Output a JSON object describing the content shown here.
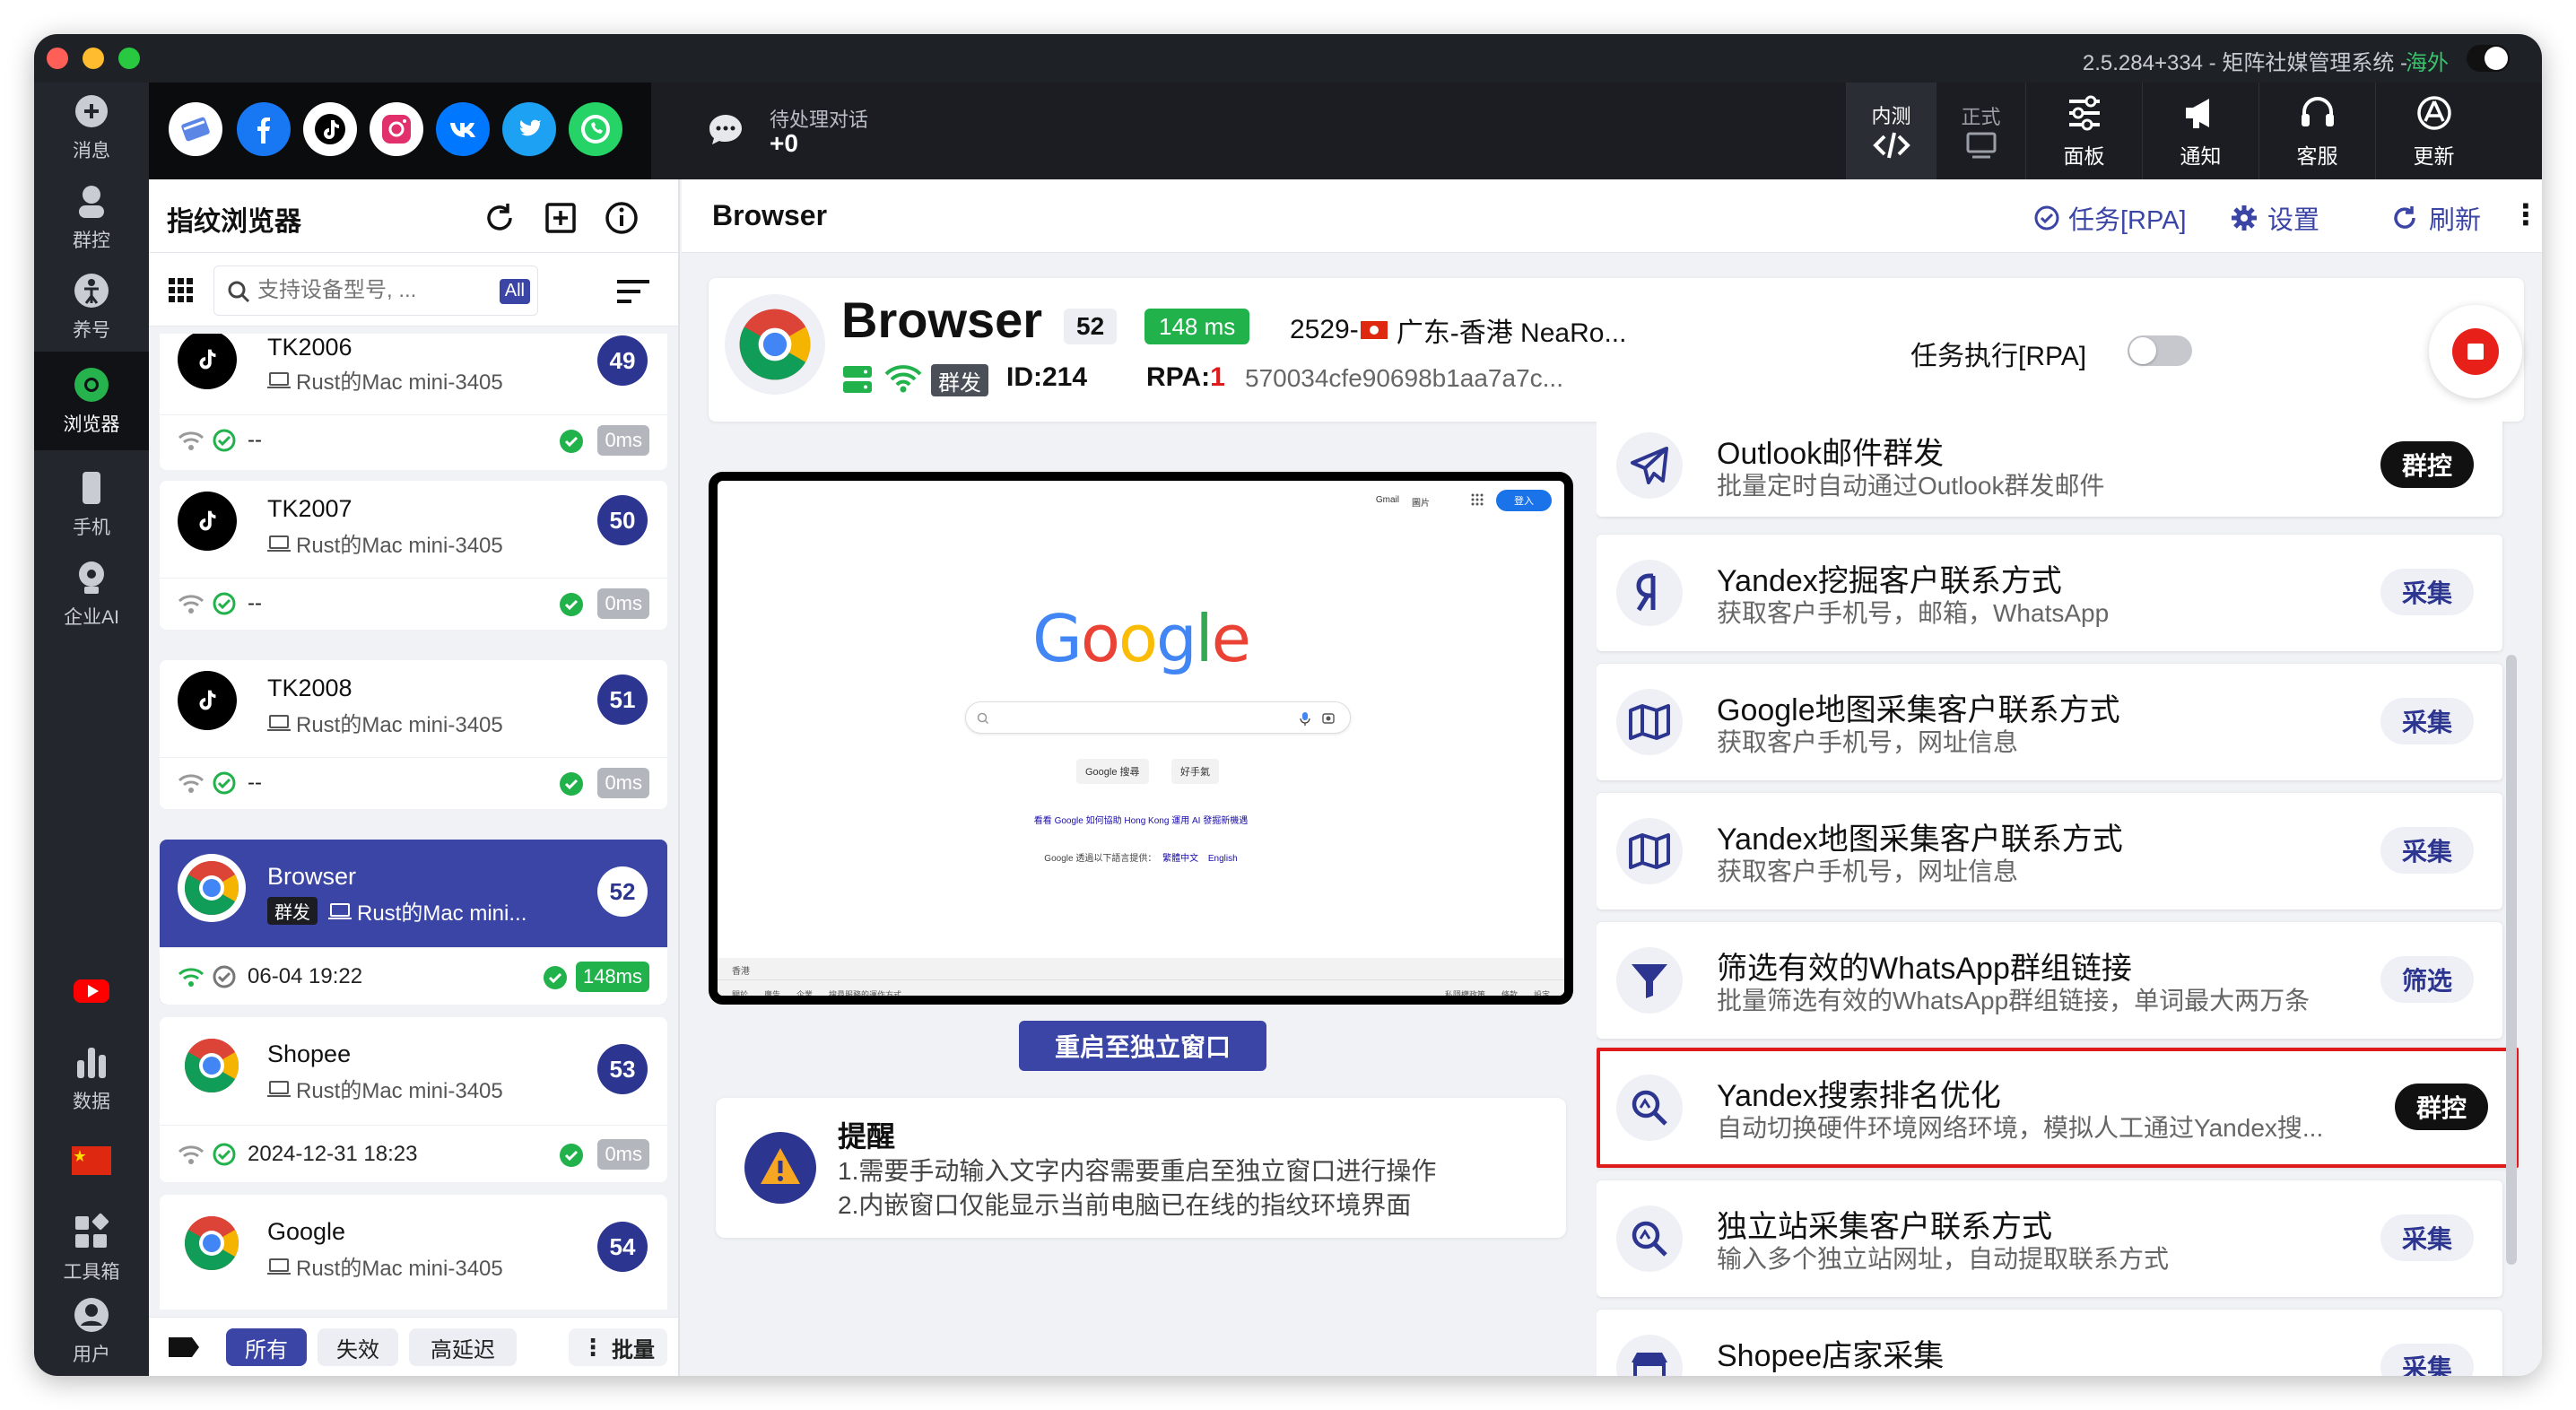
{
  "window": {
    "title": "2.5.284+334 - 矩阵社媒管理系统 - ",
    "region": "海外"
  },
  "sidebar": {
    "items": [
      {
        "label": "消息",
        "icon": "message-icon"
      },
      {
        "label": "群控",
        "icon": "group-control-icon"
      },
      {
        "label": "养号",
        "icon": "account-nurture-icon"
      },
      {
        "label": "浏览器",
        "icon": "browser-icon",
        "active": true
      },
      {
        "label": "手机",
        "icon": "phone-icon"
      },
      {
        "label": "企业AI",
        "icon": "enterprise-ai-icon"
      },
      {
        "label": "数据",
        "icon": "data-chart-icon"
      },
      {
        "label": "工具箱",
        "icon": "toolbox-icon"
      },
      {
        "label": "用户",
        "icon": "user-icon"
      }
    ]
  },
  "topbar": {
    "pending_label": "待处理对话",
    "pending_count": "+0",
    "env_test": "内测",
    "env_prod": "正式",
    "tools": [
      {
        "label": "面板",
        "icon": "panel-sliders-icon"
      },
      {
        "label": "通知",
        "icon": "megaphone-icon"
      },
      {
        "label": "客服",
        "icon": "headset-icon"
      },
      {
        "label": "更新",
        "icon": "update-icon"
      }
    ]
  },
  "left_panel": {
    "title": "指纹浏览器",
    "search_placeholder": "支持设备型号, ...",
    "filter_all": "All",
    "filters": [
      "所有",
      "失效",
      "高延迟"
    ],
    "batch_label": "批量",
    "cards": [
      {
        "name": "TK2006",
        "device": "Rust的Mac mini-3405",
        "num": "49",
        "app": "tiktok",
        "status": "--",
        "latency": "0ms"
      },
      {
        "name": "TK2007",
        "device": "Rust的Mac mini-3405",
        "num": "50",
        "app": "tiktok",
        "status": "--",
        "latency": "0ms"
      },
      {
        "name": "TK2008",
        "device": "Rust的Mac mini-3405",
        "num": "51",
        "app": "tiktok",
        "status": "--",
        "latency": "0ms"
      },
      {
        "name": "Browser",
        "tag": "群发",
        "device": "Rust的Mac mini...",
        "num": "52",
        "app": "chrome",
        "status": "06-04 19:22",
        "latency": "148ms",
        "selected": true
      },
      {
        "name": "Shopee",
        "device": "Rust的Mac mini-3405",
        "num": "53",
        "app": "chrome",
        "status": "2024-12-31 18:23",
        "latency": "0ms"
      },
      {
        "name": "Google",
        "device": "Rust的Mac mini-3405",
        "num": "54",
        "app": "chrome",
        "status": "",
        "latency": ""
      }
    ]
  },
  "main": {
    "header_title": "Browser",
    "actions": {
      "task": "任务[RPA]",
      "settings": "设置",
      "refresh": "刷新"
    },
    "browser_card": {
      "name": "Browser",
      "num": "52",
      "latency": "148 ms",
      "location_prefix": "2529-",
      "location": "广东-香港 NeaRo...",
      "tag": "群发",
      "id": "ID:214",
      "rpa_label": "RPA:",
      "rpa_value": "1",
      "hash": "570034cfe90698b1aa7a7c...",
      "task_toggle_label": "任务执行[RPA]"
    },
    "preview": {
      "logo": "Google",
      "search_btn": "Google 搜尋",
      "lucky_btn": "好手氣",
      "promo": "看看 Google 如何協助 Hong Kong 運用 AI 發掘新機遇",
      "lang_text": "Google 透過以下語言提供：",
      "lang_1": "繁體中文",
      "lang_2": "English",
      "top_links": [
        "Gmail",
        "圖片"
      ],
      "signin": "登入",
      "region": "香港",
      "footer_left": [
        "關於",
        "廣告",
        "企業",
        "搜尋服務的運作方式"
      ],
      "footer_right": [
        "私隱權政策",
        "條款",
        "設定"
      ]
    },
    "restart_label": "重启至独立窗口",
    "remind": {
      "title": "提醒",
      "line1": "1.需要手动输入文字内容需要重启至独立窗口进行操作",
      "line2": "2.内嵌窗口仅能显示当前电脑已在线的指纹环境界面"
    },
    "tasks": [
      {
        "title": "Outlook邮件群发",
        "desc": "批量定时自动通过Outlook群发邮件",
        "badge": "群控",
        "style": "dark",
        "icon": "paper-plane-icon"
      },
      {
        "title": "Yandex挖掘客户联系方式",
        "desc": "获取客户手机号，邮箱，WhatsApp",
        "badge": "采集",
        "style": "light",
        "icon": "yandex-icon"
      },
      {
        "title": "Google地图采集客户联系方式",
        "desc": "获取客户手机号，网址信息",
        "badge": "采集",
        "style": "light",
        "icon": "map-icon"
      },
      {
        "title": "Yandex地图采集客户联系方式",
        "desc": "获取客户手机号，网址信息",
        "badge": "采集",
        "style": "light",
        "icon": "map-icon"
      },
      {
        "title": "筛选有效的WhatsApp群组链接",
        "desc": "批量筛选有效的WhatsApp群组链接，单词最大两万条",
        "badge": "筛选",
        "style": "light",
        "icon": "filter-funnel-icon"
      },
      {
        "title": "Yandex搜索排名优化",
        "desc": "自动切换硬件环境网络环境，模拟人工通过Yandex搜...",
        "badge": "群控",
        "style": "dark",
        "icon": "search-rank-icon",
        "highlight": true
      },
      {
        "title": "独立站采集客户联系方式",
        "desc": "输入多个独立站网址，自动提取联系方式",
        "badge": "采集",
        "style": "light",
        "icon": "search-rank-icon"
      },
      {
        "title": "Shopee店家采集",
        "desc": "",
        "badge": "采集",
        "style": "light",
        "icon": "shop-icon"
      }
    ]
  }
}
